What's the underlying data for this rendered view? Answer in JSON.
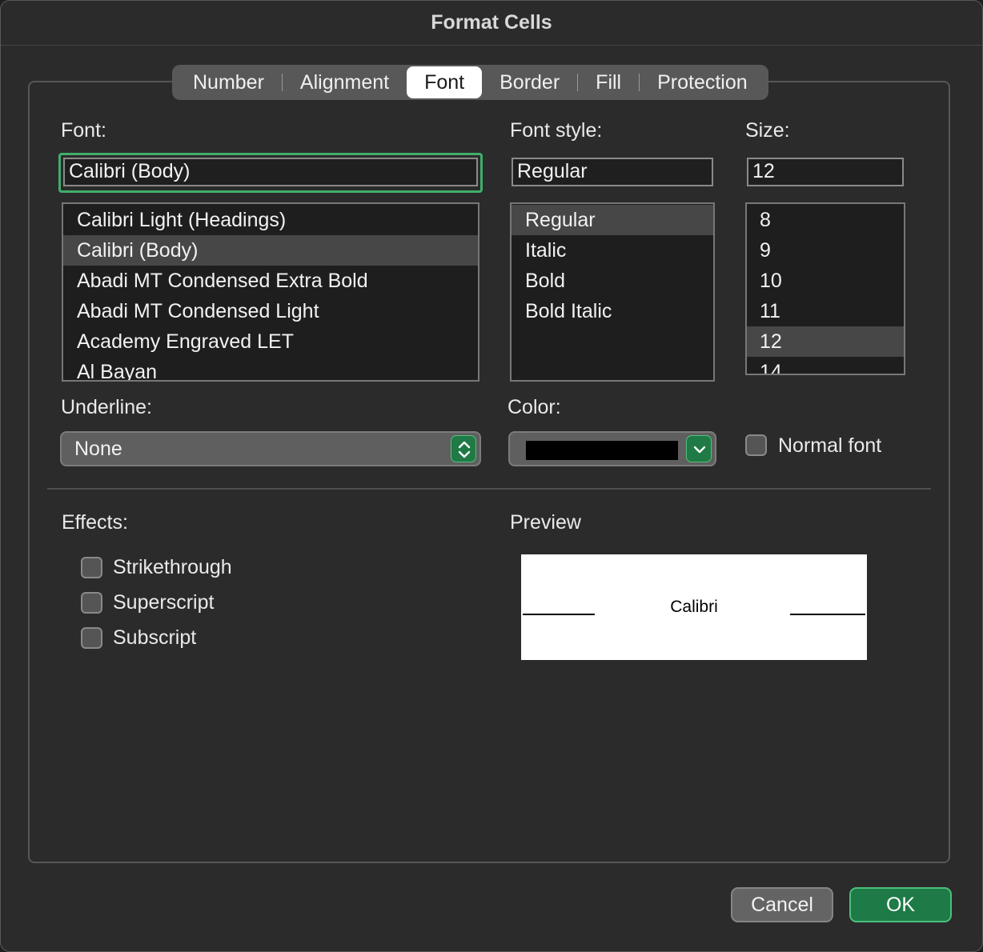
{
  "window": {
    "title": "Format Cells"
  },
  "tabs": [
    {
      "label": "Number"
    },
    {
      "label": "Alignment"
    },
    {
      "label": "Font",
      "selected": true
    },
    {
      "label": "Border"
    },
    {
      "label": "Fill"
    },
    {
      "label": "Protection"
    }
  ],
  "font": {
    "label": "Font:",
    "value": "Calibri (Body)",
    "list": [
      "Calibri Light (Headings)",
      "Calibri (Body)",
      "Abadi MT Condensed Extra Bold",
      "Abadi MT Condensed Light",
      "Academy Engraved LET",
      "Al Bayan"
    ],
    "selected": "Calibri (Body)"
  },
  "font_style": {
    "label": "Font style:",
    "value": "Regular",
    "list": [
      "Regular",
      "Italic",
      "Bold",
      "Bold Italic"
    ],
    "selected": "Regular"
  },
  "size": {
    "label": "Size:",
    "value": "12",
    "list": [
      "8",
      "9",
      "10",
      "11",
      "12",
      "14"
    ],
    "selected": "12"
  },
  "underline": {
    "label": "Underline:",
    "value": "None"
  },
  "color": {
    "label": "Color:",
    "swatch": "#000000",
    "accent": "#1f7a45"
  },
  "normal_font": {
    "label": "Normal font",
    "checked": false
  },
  "effects": {
    "label": "Effects:",
    "options": [
      {
        "label": "Strikethrough",
        "checked": false
      },
      {
        "label": "Superscript",
        "checked": false
      },
      {
        "label": "Subscript",
        "checked": false
      }
    ]
  },
  "preview": {
    "label": "Preview",
    "sample": "Calibri"
  },
  "buttons": {
    "cancel": "Cancel",
    "ok": "OK"
  }
}
